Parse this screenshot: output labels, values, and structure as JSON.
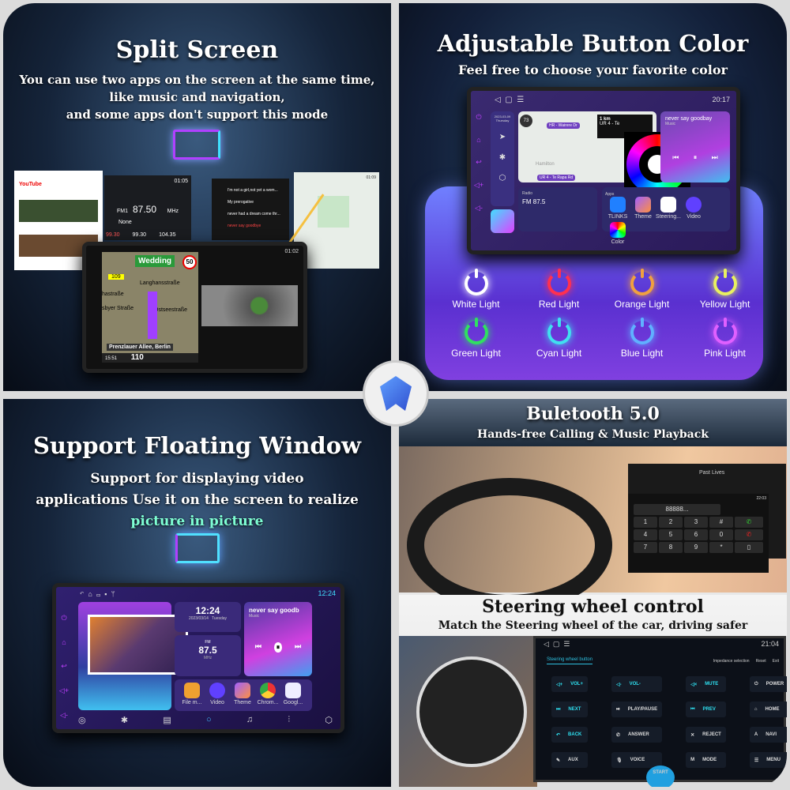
{
  "split": {
    "title": "Split Screen",
    "desc": [
      "You can use two apps on the screen at the same time,",
      "like music and navigation,",
      "and some apps don't support this mode"
    ],
    "radio": {
      "freq": "87.50",
      "band": "FM1",
      "unit": "MHz",
      "label": "None",
      "time": "01:05",
      "presets": [
        "99.30",
        "99.30",
        "104.35"
      ]
    },
    "playlist": [
      "I'm not a girl,not yet a wom...",
      "My prerogative",
      "never had a dream come thr...",
      "never say goodbye"
    ],
    "nav": {
      "sign": "Wedding",
      "speed_limit": "50",
      "road_no": "109",
      "streets": [
        "Langhansstraße",
        "hastraße",
        "sbyer Straße",
        "Ostseestraße"
      ],
      "location": "Prenzlauer Allee, Berlin",
      "distance": "110",
      "eta": "15:51",
      "time": "01:02"
    },
    "youtube_label": "YouTube",
    "maps_time": "01:09"
  },
  "color": {
    "title": "Adjustable Button Color",
    "subtitle": "Feel free to choose your favorite color",
    "screen": {
      "time": "20:17",
      "date": "2023-03-09",
      "weekday": "Thursday",
      "nav_dist": "1 km",
      "nav_road": "UR 4 - Te",
      "nav_tag": "HR - Wairere Dr",
      "nav_bottom": "UR 4 - Te Rapa Rd",
      "map_place": "Hamilton",
      "speed": "73",
      "song": "never say goodbay",
      "song_sub": "Music",
      "radio_label": "Radio",
      "radio_freq": "FM 87.5",
      "apps_label": "Apps",
      "apps": [
        "TLINKS",
        "Theme",
        "Steering...",
        "Video",
        "Color"
      ]
    },
    "lights": [
      {
        "label": "White Light",
        "color": "#ffffff"
      },
      {
        "label": "Red Light",
        "color": "#ff3050"
      },
      {
        "label": "Orange Light",
        "color": "#f0a040"
      },
      {
        "label": "Yellow Light",
        "color": "#e8f060"
      },
      {
        "label": "Green Light",
        "color": "#30e060"
      },
      {
        "label": "Cyan Light",
        "color": "#40e0f0"
      },
      {
        "label": "Blue Light",
        "color": "#60b0ff"
      },
      {
        "label": "Pink Light",
        "color": "#e060ff"
      }
    ]
  },
  "floating": {
    "title": "Support Floating Window",
    "desc": [
      "Support for displaying video",
      "applications Use it on the screen to realize"
    ],
    "highlight": "picture in picture",
    "highlight_color": "#7fffd4",
    "screen": {
      "time": "12:24",
      "clock": "12:24",
      "date": "2023/03/14",
      "weekday": "Tuesday",
      "band": "FM",
      "freq": "87.5",
      "unit": "MHz",
      "song": "never say goodb",
      "song_sub": "Music",
      "apps": [
        "File m...",
        "Video",
        "Theme",
        "Chrom...",
        "Googl..."
      ]
    }
  },
  "bluetooth": {
    "title": "Buletooth 5.0",
    "subtitle": "Hands-free Calling & Music Playback",
    "song": "Past Lives",
    "dial": "88888...",
    "time": "22:03",
    "keys": [
      "1",
      "2",
      "3",
      "#",
      "4",
      "5",
      "6",
      "0",
      "7",
      "8",
      "9",
      "*"
    ]
  },
  "steering": {
    "title": "Steering wheel control",
    "subtitle": "Match the Steering wheel of the car, driving safer",
    "screen": {
      "time": "21:04",
      "tab": "Steering wheel button",
      "options": [
        "Impedance selection",
        "Reset",
        "Exit"
      ],
      "start": "START",
      "buttons": [
        "VOL+",
        "VOL-",
        "MUTE",
        "POWER",
        "NEXT",
        "PLAY/PAUSE",
        "PREV",
        "HOME",
        "BACK",
        "ANSWER",
        "REJECT",
        "NAVI",
        "AUX",
        "VOICE",
        "MODE",
        "MENU"
      ]
    }
  }
}
